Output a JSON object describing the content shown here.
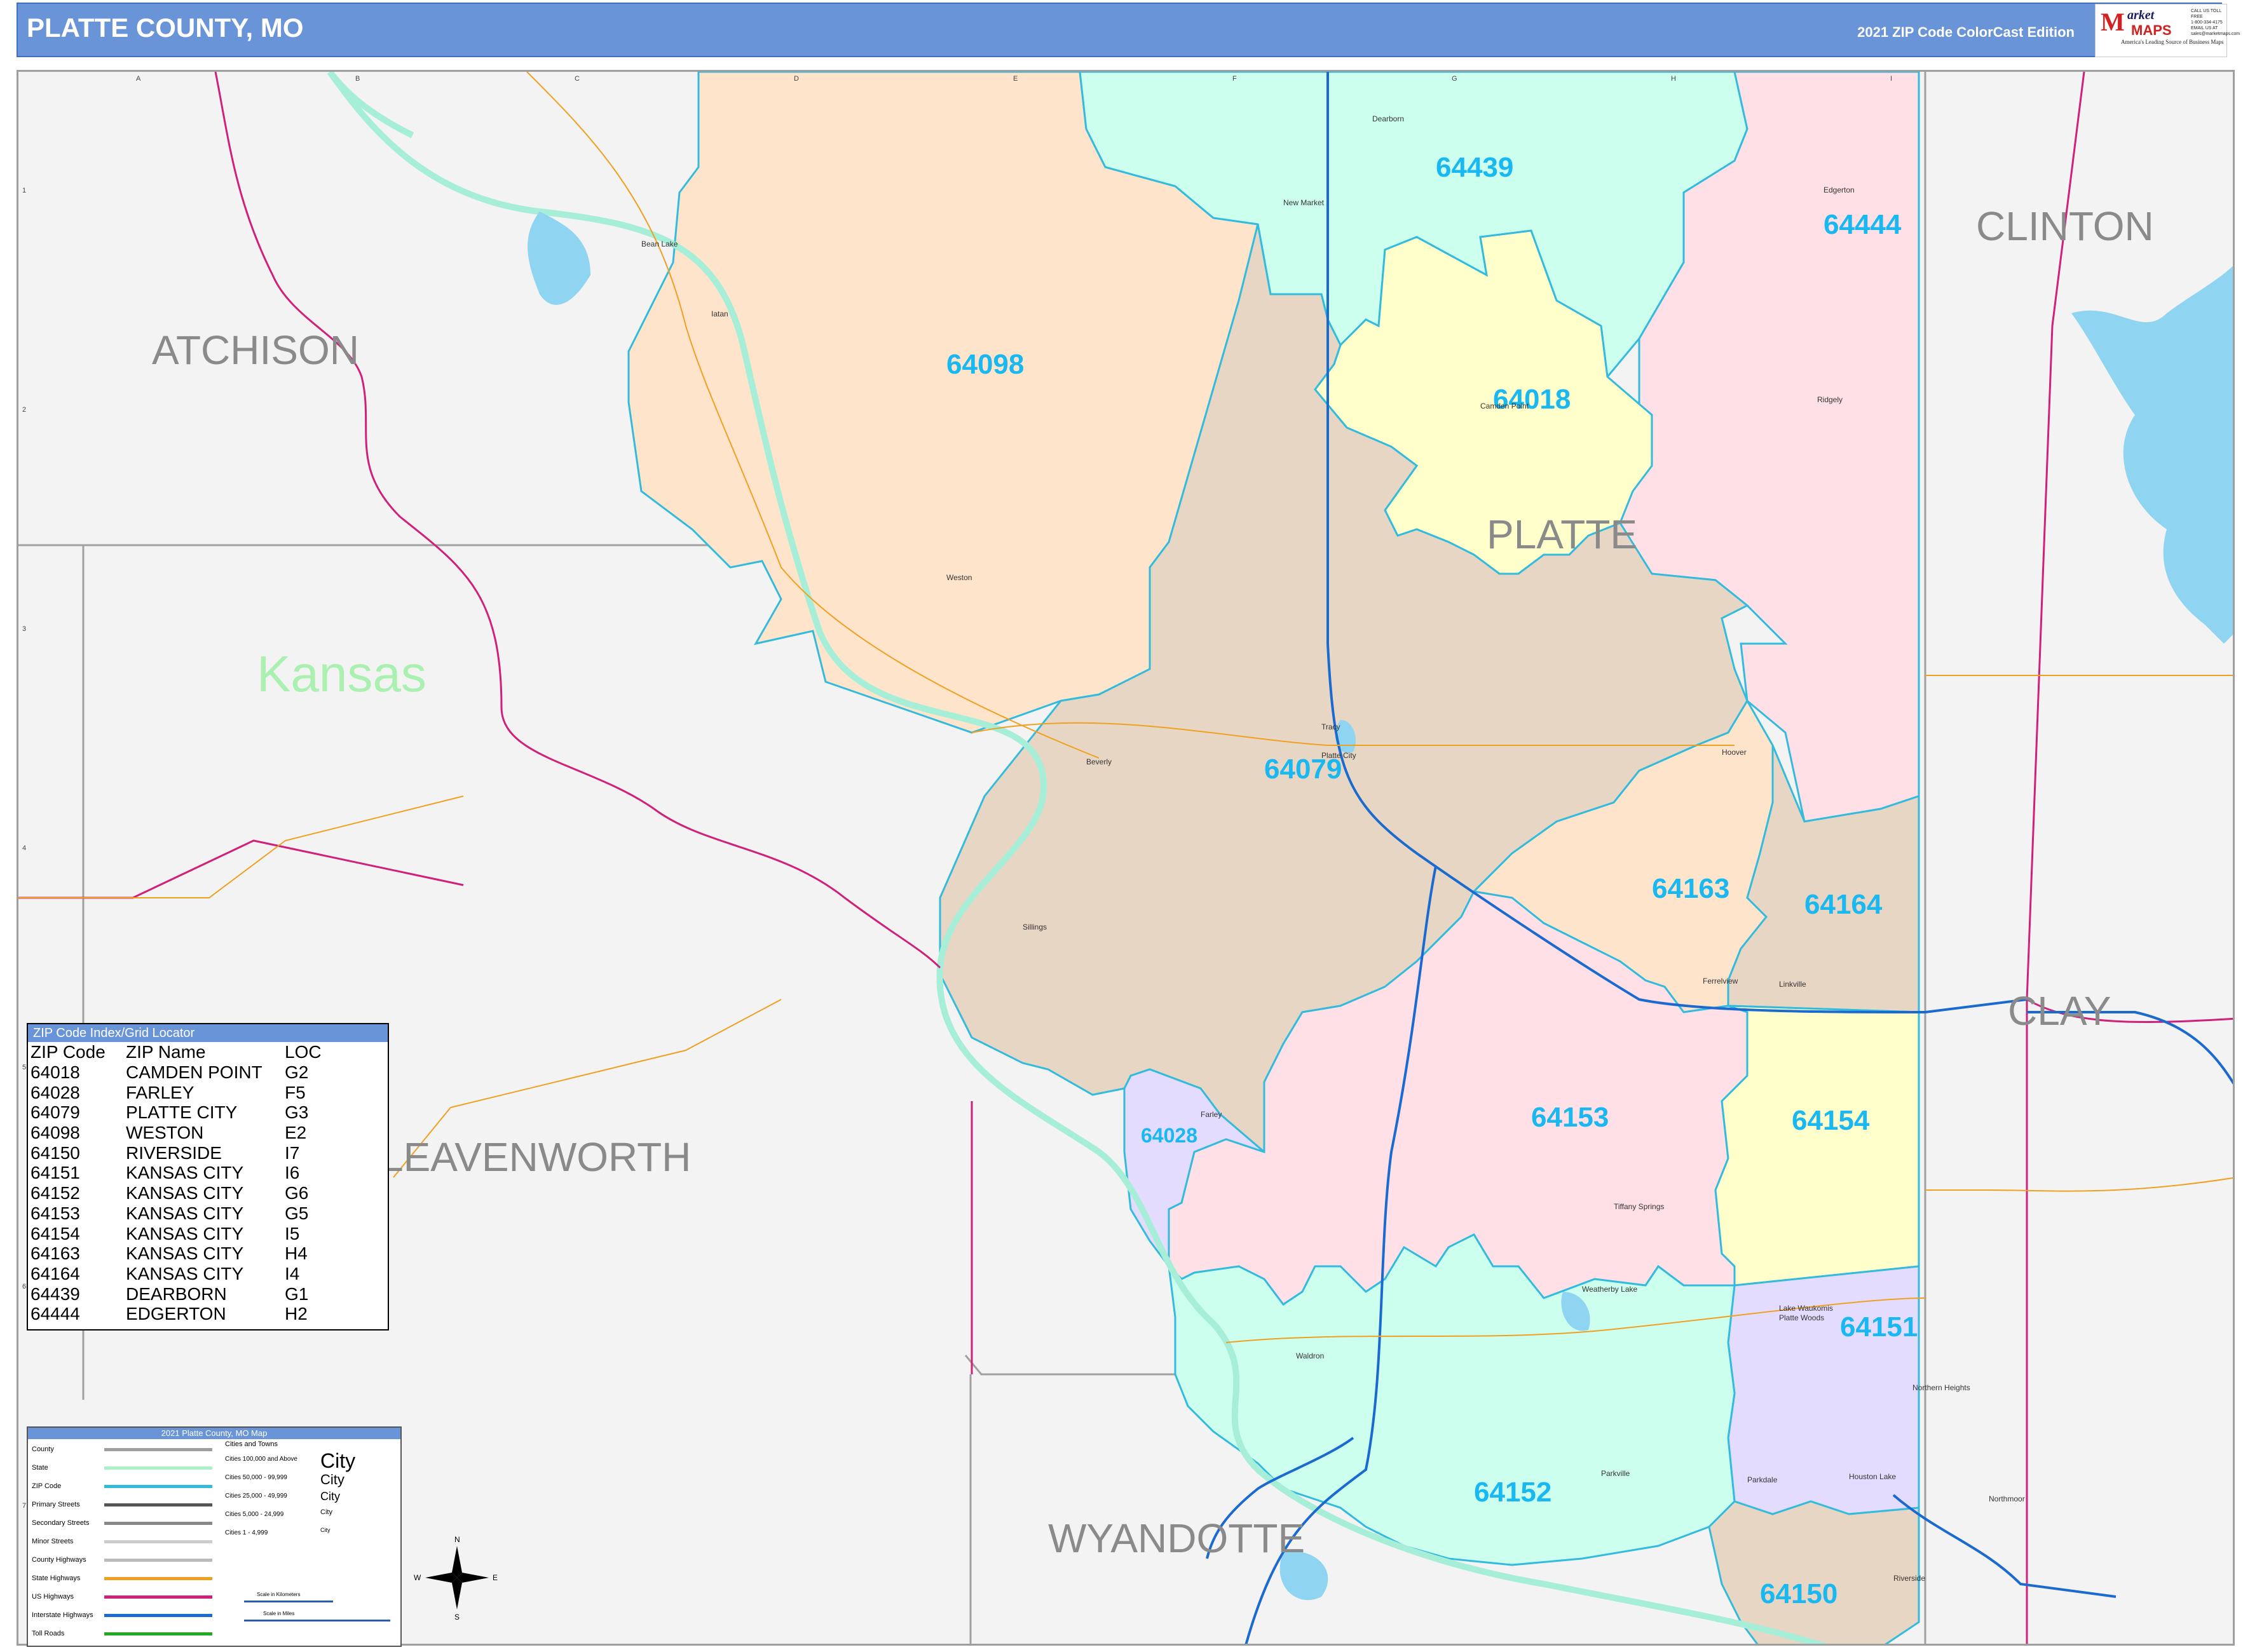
{
  "header": {
    "title": "PLATTE COUNTY, MO",
    "edition": "2021 ZIP Code ColorCast Edition",
    "logo": {
      "mark": "M",
      "word1": "arket",
      "word2": "MAPS",
      "tagline": "America's Leading Source of Business Maps",
      "slogan": "On Target, On Time",
      "contact": [
        "CALL US TOLL FREE",
        "1-800-334-4175",
        "EMAIL US AT",
        "sales@marketmaps.com"
      ]
    }
  },
  "grid": {
    "columns": [
      "A",
      "B",
      "C",
      "D",
      "E",
      "F",
      "G",
      "H",
      "I"
    ],
    "rows": [
      "1",
      "2",
      "3",
      "4",
      "5",
      "6",
      "7"
    ]
  },
  "counties": {
    "atchison": "ATCHISON",
    "clinton": "CLINTON",
    "platte": "PLATTE",
    "clay": "CLAY",
    "leavenworth": "LEAVENWORTH",
    "wyandotte": "WYANDOTTE"
  },
  "state_label": "Kansas",
  "zips": [
    {
      "code": "64439",
      "color": "#ccffee"
    },
    {
      "code": "64444",
      "color": "#ffe0e6"
    },
    {
      "code": "64098",
      "color": "#ffe4cc"
    },
    {
      "code": "64018",
      "color": "#ffffcc"
    },
    {
      "code": "64079",
      "color": "#e8d6c4"
    },
    {
      "code": "64163",
      "color": "#ffe4cc"
    },
    {
      "code": "64164",
      "color": "#e8d6c4"
    },
    {
      "code": "64153",
      "color": "#ffe0e6"
    },
    {
      "code": "64154",
      "color": "#ffffcc"
    },
    {
      "code": "64028",
      "color": "#e4dcff"
    },
    {
      "code": "64151",
      "color": "#e4dcff"
    },
    {
      "code": "64152",
      "color": "#ccffee"
    },
    {
      "code": "64150",
      "color": "#e8d6c4"
    }
  ],
  "places": [
    "Dearborn",
    "New Market",
    "Edgerton",
    "Camden Point",
    "Ridgely",
    "Weston",
    "Iatan",
    "Tracy",
    "Platte City",
    "Beverly",
    "Hoover",
    "Farley",
    "Waldron",
    "Parkville",
    "Houston Lake",
    "Riverside",
    "Northmoor",
    "Lake Waukomis",
    "Platte Woods",
    "Tiffany Springs",
    "Weatherby Lake",
    "Northern Heights",
    "Ferrelview",
    "Linkville",
    "Sillings",
    "Bean Lake",
    "Parkdale"
  ],
  "zip_index": {
    "title": "ZIP Code Index/Grid Locator",
    "headers": [
      "ZIP Code",
      "ZIP Name",
      "LOC"
    ],
    "rows": [
      [
        "64018",
        "CAMDEN POINT",
        "G2"
      ],
      [
        "64028",
        "FARLEY",
        "F5"
      ],
      [
        "64079",
        "PLATTE CITY",
        "G3"
      ],
      [
        "64098",
        "WESTON",
        "E2"
      ],
      [
        "64150",
        "RIVERSIDE",
        "I7"
      ],
      [
        "64151",
        "KANSAS CITY",
        "I6"
      ],
      [
        "64152",
        "KANSAS CITY",
        "G6"
      ],
      [
        "64153",
        "KANSAS CITY",
        "G5"
      ],
      [
        "64154",
        "KANSAS CITY",
        "I5"
      ],
      [
        "64163",
        "KANSAS CITY",
        "H4"
      ],
      [
        "64164",
        "KANSAS CITY",
        "I4"
      ],
      [
        "64439",
        "DEARBORN",
        "G1"
      ],
      [
        "64444",
        "EDGERTON",
        "H2"
      ]
    ]
  },
  "legend": {
    "title": "2021 Platte County, MO Map",
    "line_items": [
      "County",
      "State",
      "ZIP Code",
      "Primary Streets",
      "Secondary Streets",
      "Minor Streets",
      "County Highways",
      "State Highways",
      "US Highways",
      "Interstate Highways",
      "Toll Roads"
    ],
    "line_colors": [
      "#9e9e9e",
      "#aaf0c8",
      "#33bbdd",
      "#555555",
      "#888888",
      "#cccccc",
      "#bbbbbb",
      "#f0a020",
      "#d0207a",
      "#1a6ad0",
      "#22aa22"
    ],
    "cities_heading": "Cities and Towns",
    "city_sizes": [
      "Cities 100,000 and Above",
      "Cities 50,000 - 99,999",
      "Cities 25,000 - 49,999",
      "Cities 5,000 - 24,999",
      "Cities 1 - 4,999"
    ],
    "city_samples": [
      "City",
      "City",
      "City",
      "City",
      "City"
    ],
    "scale_km": "Scale in Kilometers",
    "scale_mi": "Scale in Miles"
  },
  "compass": {
    "n": "N",
    "s": "S",
    "e": "E",
    "w": "W"
  },
  "colors": {
    "header": "#6994d8",
    "zip_label": "#1ab8f0",
    "zip_border": "#33bbdd",
    "county_label": "#8a8a8a",
    "state_label": "#aaf0b0",
    "river": "#a6eed8",
    "us_highway": "#d0207a",
    "interstate": "#1a6ad0",
    "state_highway": "#f0a020",
    "water": "#8fd4f0"
  }
}
